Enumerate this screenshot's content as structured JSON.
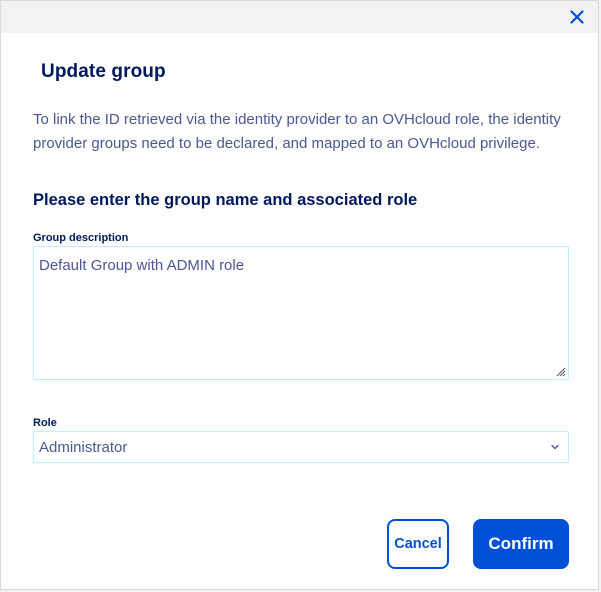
{
  "dialog": {
    "title": "Update group",
    "description": "To link the ID retrieved via the identity provider to an OVHcloud role, the identity provider groups need to be declared, and mapped to an OVHcloud privilege.",
    "subtitle": "Please enter the group name and associated role",
    "close_icon": "close-icon"
  },
  "form": {
    "description_label": "Group description",
    "description_value": "Default Group with ADMIN role",
    "role_label": "Role",
    "role_selected": "Administrator"
  },
  "actions": {
    "cancel_label": "Cancel",
    "confirm_label": "Confirm"
  },
  "colors": {
    "primary": "#0050d7",
    "heading": "#00185e",
    "text": "#4d5693",
    "field_border": "#bef1ff"
  }
}
